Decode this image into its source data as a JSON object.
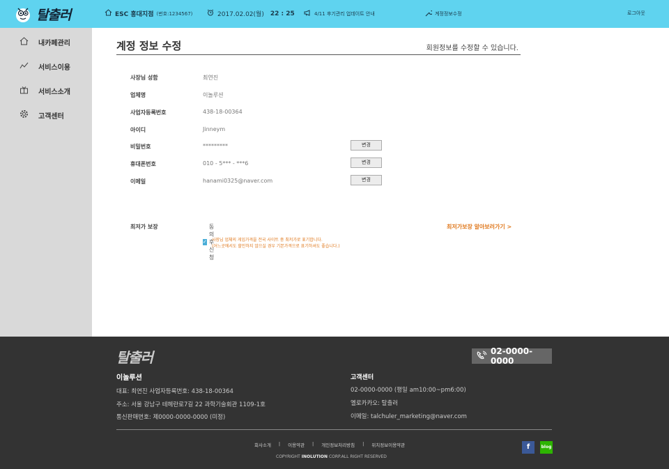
{
  "header": {
    "brand": "탈출러",
    "store_name": "ESC 홍대지점",
    "store_code": "(번호:1234567)",
    "date": "2017.02.02(월)",
    "time": "22 : 25",
    "notice": "4/11 후기관리 업데이트 안내",
    "account_edit": "계정정보수정",
    "logout": "로그아웃"
  },
  "sidebar": {
    "items": [
      {
        "label": "내카페관리",
        "icon": "home-icon"
      },
      {
        "label": "서비스이용",
        "icon": "chart-icon"
      },
      {
        "label": "서비스소개",
        "icon": "gift-icon"
      },
      {
        "label": "고객센터",
        "icon": "gear-icon"
      }
    ]
  },
  "main": {
    "title": "계정 정보 수정",
    "description": "회원정보를 수정할 수 있습니다.",
    "fields": [
      {
        "label": "사장님 성함",
        "value": "최연진"
      },
      {
        "label": "업체명",
        "value": "이놀루션"
      },
      {
        "label": "사업자등록번호",
        "value": "438-18-00364"
      },
      {
        "label": "아이디",
        "value": "Jinneym"
      },
      {
        "label": "비밀번호",
        "value": "*********",
        "button": "변경"
      },
      {
        "label": "휴대폰번호",
        "value": "010 - 5*** - ***6",
        "button": "변경"
      },
      {
        "label": "이메일",
        "value": "hanami0325@naver.com",
        "button": "변경"
      }
    ],
    "guarantee": {
      "label": "최저가 보장",
      "checkbox_label": "동의 후 신청",
      "link": "최저가보장 알아보러가기 >",
      "note_line1": "사장님 업체의 게임가격을 전국 사이트 중 최저가로 표기합니다.",
      "note_line2": "(어느곳에서도 할인하지 않으실 경우 기본가격으로 표기하셔도 좋습니다.)"
    }
  },
  "footer": {
    "brand": "탈출러",
    "phone": "02-0000-0000",
    "company": "이놀루션",
    "company_lines": [
      "대표: 최연진    사업자등록번호: 438-18-00364",
      "주소: 서울 강남구 테헤란로7길 22  과학기술회관 1109-1호",
      "통신판매번호: 제0000-0000-0000 (미정)"
    ],
    "cs_title": "고객센터",
    "cs_lines": [
      "02-0000-0000 (평일 am10:00~pm6:00)",
      "옐로카카오: 탈출러",
      "이메일: talchuler_marketing@naver.com"
    ],
    "links": [
      "회사소개",
      "|",
      "이용약관",
      "|",
      "개인정보처리방침",
      "|",
      "위치정보이용약관"
    ],
    "copyright_pre": "COPYRIGHT ",
    "copyright_bold": "INOLUTION",
    "copyright_post": " CORP.ALL RIGHT RESERVED",
    "sns": [
      {
        "label": "f",
        "color": "#3b5998"
      },
      {
        "label": "blog",
        "color": "#2db400"
      }
    ]
  },
  "colors": {
    "topbar": "#5fd3ef",
    "accent": "#e07a20",
    "footer": "#333333"
  }
}
